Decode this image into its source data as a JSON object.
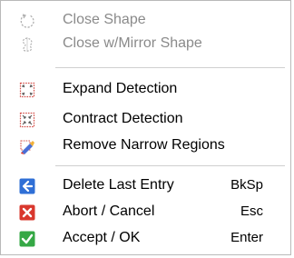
{
  "menu": {
    "items": [
      {
        "label": "Close Shape",
        "icon": "close-shape-icon",
        "enabled": false
      },
      {
        "label": "Close w/Mirror Shape",
        "icon": "close-mirror-shape-icon",
        "enabled": false
      },
      {
        "label": "Expand Detection",
        "icon": "expand-detection-icon",
        "enabled": true
      },
      {
        "label": "Contract Detection",
        "icon": "contract-detection-icon",
        "enabled": true
      },
      {
        "label": "Remove Narrow Regions",
        "icon": "remove-narrow-regions-icon",
        "enabled": true
      },
      {
        "label": "Delete Last Entry",
        "shortcut": "BkSp",
        "icon": "back-arrow-icon",
        "enabled": true
      },
      {
        "label": "Abort / Cancel",
        "shortcut": "Esc",
        "icon": "cancel-x-icon",
        "enabled": true
      },
      {
        "label": "Accept / OK",
        "shortcut": "Enter",
        "icon": "checkmark-icon",
        "enabled": true
      }
    ]
  },
  "colors": {
    "disabled_text": "#8a8a8a",
    "blue": "#2f6fd6",
    "red": "#d9382e",
    "green": "#35a845",
    "dotted_red": "#d4504a"
  }
}
